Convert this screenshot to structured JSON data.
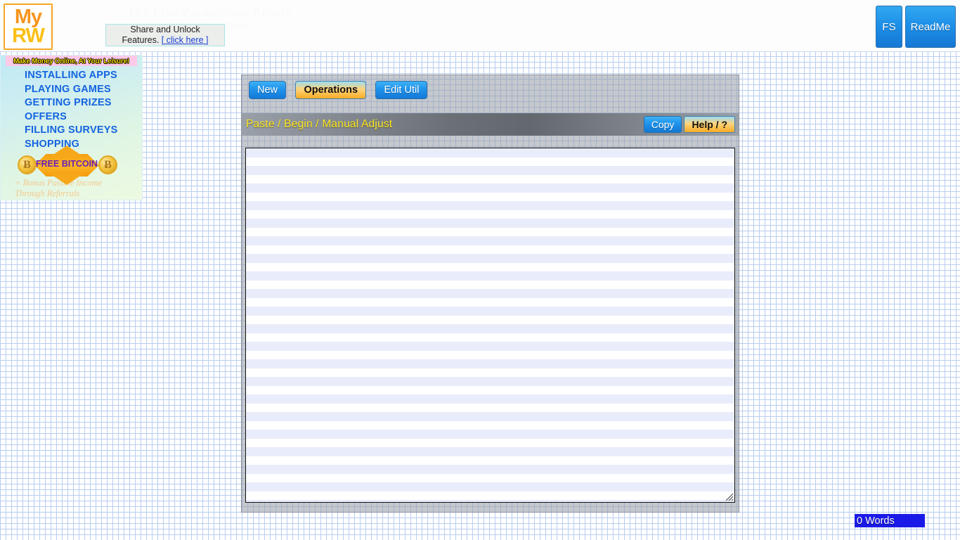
{
  "header": {
    "logo_line1": "My",
    "logo_line2": "RW",
    "ghost_title": "The Free Paraphrase Article Rewriter Tool",
    "share_line1": "Share and Unlock",
    "share_line2_prefix": "Features.",
    "share_link": "[ click here ]",
    "fs_button": "FS",
    "readme_button": "ReadMe"
  },
  "sidebar": {
    "banner": "Make Money Online, At Your Leisure!",
    "items": [
      {
        "label": "INSTALLING APPS"
      },
      {
        "label": "PLAYING GAMES"
      },
      {
        "label": "GETTING PRIZES"
      },
      {
        "label": "OFFERS"
      },
      {
        "label": "FILLING SURVEYS"
      },
      {
        "label": "SHOPPING"
      }
    ],
    "star_label": "FREE BITCOIN",
    "coin_glyph": "Ƀ",
    "bonus_line1": "+ Bonus Passive Income",
    "bonus_line2": "Through Referrals"
  },
  "panel": {
    "tabs": [
      {
        "label": "New",
        "style": "blue",
        "active": false
      },
      {
        "label": "Operations",
        "style": "gold",
        "active": true
      },
      {
        "label": "Edit Util",
        "style": "blue",
        "active": false
      }
    ],
    "subbar_title": "Paste / Begin / Manual Adjust",
    "copy_button": "Copy",
    "help_button": "Help / ?",
    "editor_value": "",
    "editor_placeholder": ""
  },
  "status": {
    "word_count": "0 Words"
  },
  "colors": {
    "accent_blue": "#1f93ec",
    "accent_gold": "#f6ab23",
    "grid_line": "#b9cdf0",
    "subbar_title": "#ffe71e",
    "wordcount_bg": "#1a1ae8"
  }
}
